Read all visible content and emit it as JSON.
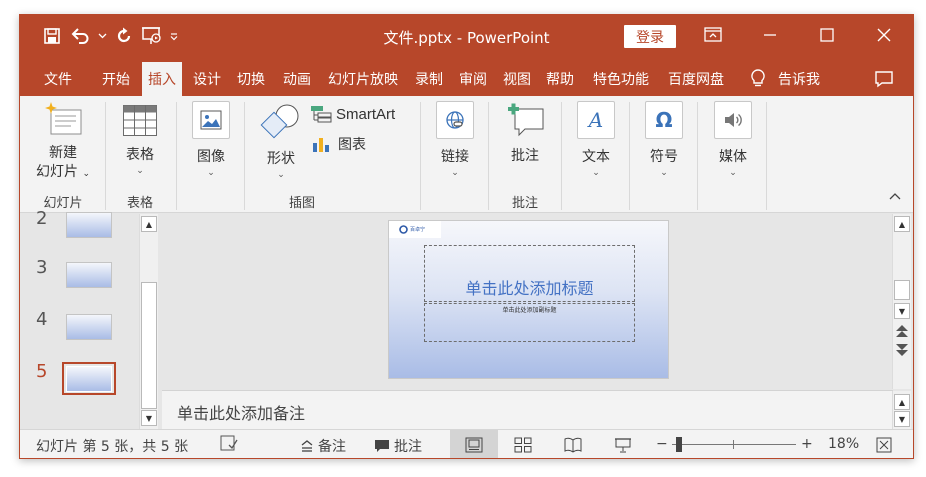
{
  "title_bar": {
    "document_title": "文件.pptx  -  PowerPoint",
    "login_label": "登录",
    "quick_access": [
      "save-icon",
      "undo-icon",
      "undo-dropdown-icon",
      "repeat-icon",
      "present-from-start-icon",
      "customize-qat-icon"
    ]
  },
  "tabs": [
    {
      "label": "文件"
    },
    {
      "label": "开始"
    },
    {
      "label": "插入",
      "active": true
    },
    {
      "label": "设计"
    },
    {
      "label": "切换"
    },
    {
      "label": "动画"
    },
    {
      "label": "幻灯片放映"
    },
    {
      "label": "录制"
    },
    {
      "label": "审阅"
    },
    {
      "label": "视图"
    },
    {
      "label": "帮助"
    },
    {
      "label": "特色功能"
    },
    {
      "label": "百度网盘"
    },
    {
      "label": "告诉我"
    }
  ],
  "ribbon": {
    "new_slide": "新建\n幻灯片",
    "new_slide_line1": "新建",
    "new_slide_line2": "幻灯片",
    "table": "表格",
    "image": "图像",
    "shape": "形状",
    "smartart": "SmartArt",
    "chart": "图表",
    "link": "链接",
    "comment": "批注",
    "text": "文本",
    "symbol": "符号",
    "media": "媒体",
    "groups": {
      "slides": "幻灯片",
      "tables": "表格",
      "illustrations": "插图",
      "comments": "批注"
    }
  },
  "thumbnails": {
    "numbers": [
      "2",
      "3",
      "4",
      "5"
    ],
    "selected": "5"
  },
  "slide": {
    "logo_text": "百卓宁",
    "title_placeholder": "单击此处添加标题",
    "subtitle_placeholder": "单击此处添加副标题"
  },
  "notes": {
    "placeholder": "单击此处添加备注"
  },
  "status_bar": {
    "slide_info": "幻灯片 第 5 张，共 5 张",
    "notes_label": "备注",
    "comments_label": "批注",
    "zoom": "18%"
  },
  "colors": {
    "accent": "#b7472a",
    "ribbon_bg": "#f3f3f3",
    "workspace_bg": "#e6e6e6",
    "title_placeholder_text": "#4472c4"
  }
}
